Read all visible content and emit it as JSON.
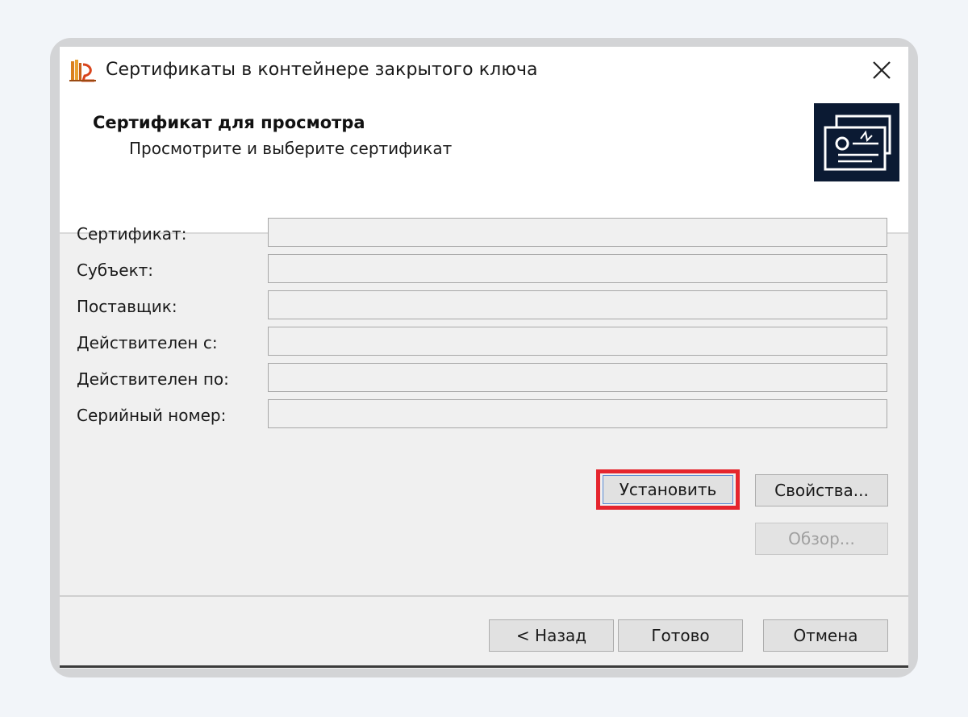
{
  "window": {
    "title": "Сертификаты в контейнере закрытого ключа",
    "close_icon": "close-icon"
  },
  "header": {
    "title": "Сертификат для просмотра",
    "subtitle": "Просмотрите и выберите сертификат"
  },
  "form": {
    "fields": [
      {
        "label": "Сертификат:",
        "value": ""
      },
      {
        "label": "Субъект:",
        "value": ""
      },
      {
        "label": "Поставщик:",
        "value": ""
      },
      {
        "label": "Действителен с:",
        "value": ""
      },
      {
        "label": "Действителен по:",
        "value": ""
      },
      {
        "label": "Серийный номер:",
        "value": ""
      }
    ]
  },
  "actions": {
    "install": "Установить",
    "properties": "Свойства...",
    "browse": "Обзор..."
  },
  "footer": {
    "back": "< Назад",
    "finish": "Готово",
    "cancel": "Отмена"
  },
  "colors": {
    "highlight": "#e5252e",
    "header_image_bg": "#0b1a33"
  }
}
